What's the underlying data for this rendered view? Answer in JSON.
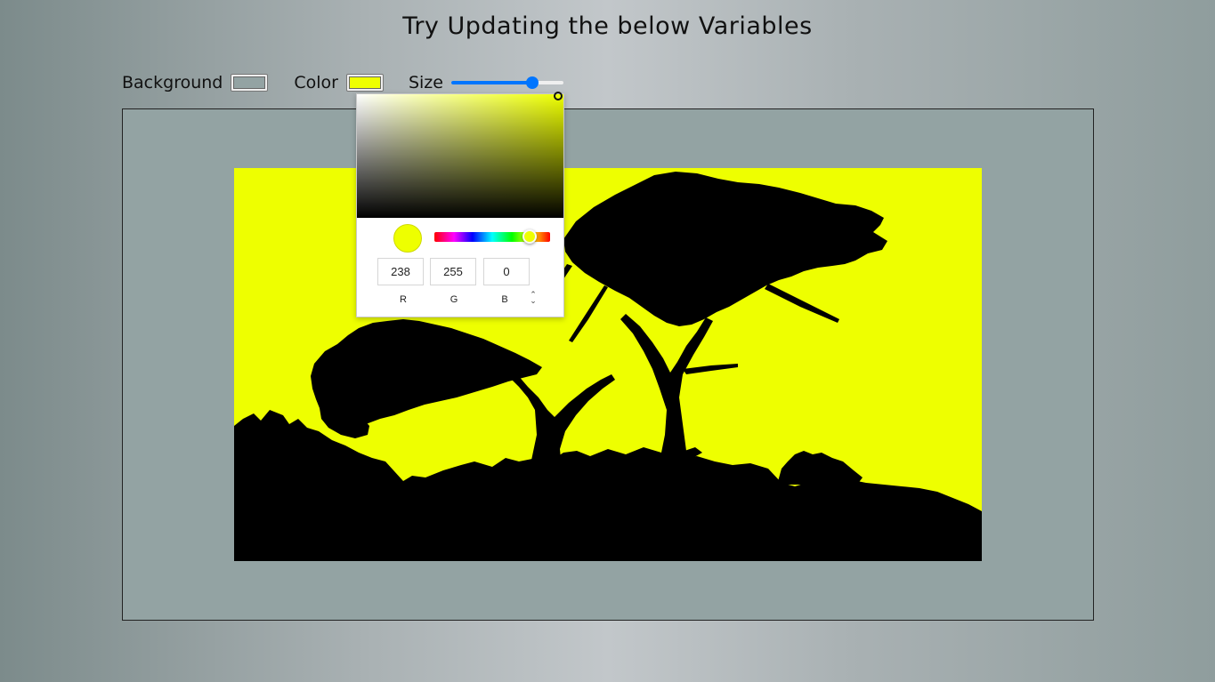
{
  "heading": "Try Updating the below Variables",
  "controls": {
    "background_label": "Background",
    "background_value": "#93a3a3",
    "color_label": "Color",
    "color_value": "#eeff00",
    "size_label": "Size",
    "size_fraction": 0.75
  },
  "picker": {
    "r": "238",
    "g": "255",
    "b": "0",
    "r_label": "R",
    "g_label": "G",
    "b_label": "B",
    "mode_toggle_icon": "up-down-chevron-icon",
    "hue_fraction": 0.82,
    "saturation": 1.0,
    "brightness": 1.0
  },
  "colors": {
    "accent": "#0075ff",
    "silhouette": "#000000"
  }
}
